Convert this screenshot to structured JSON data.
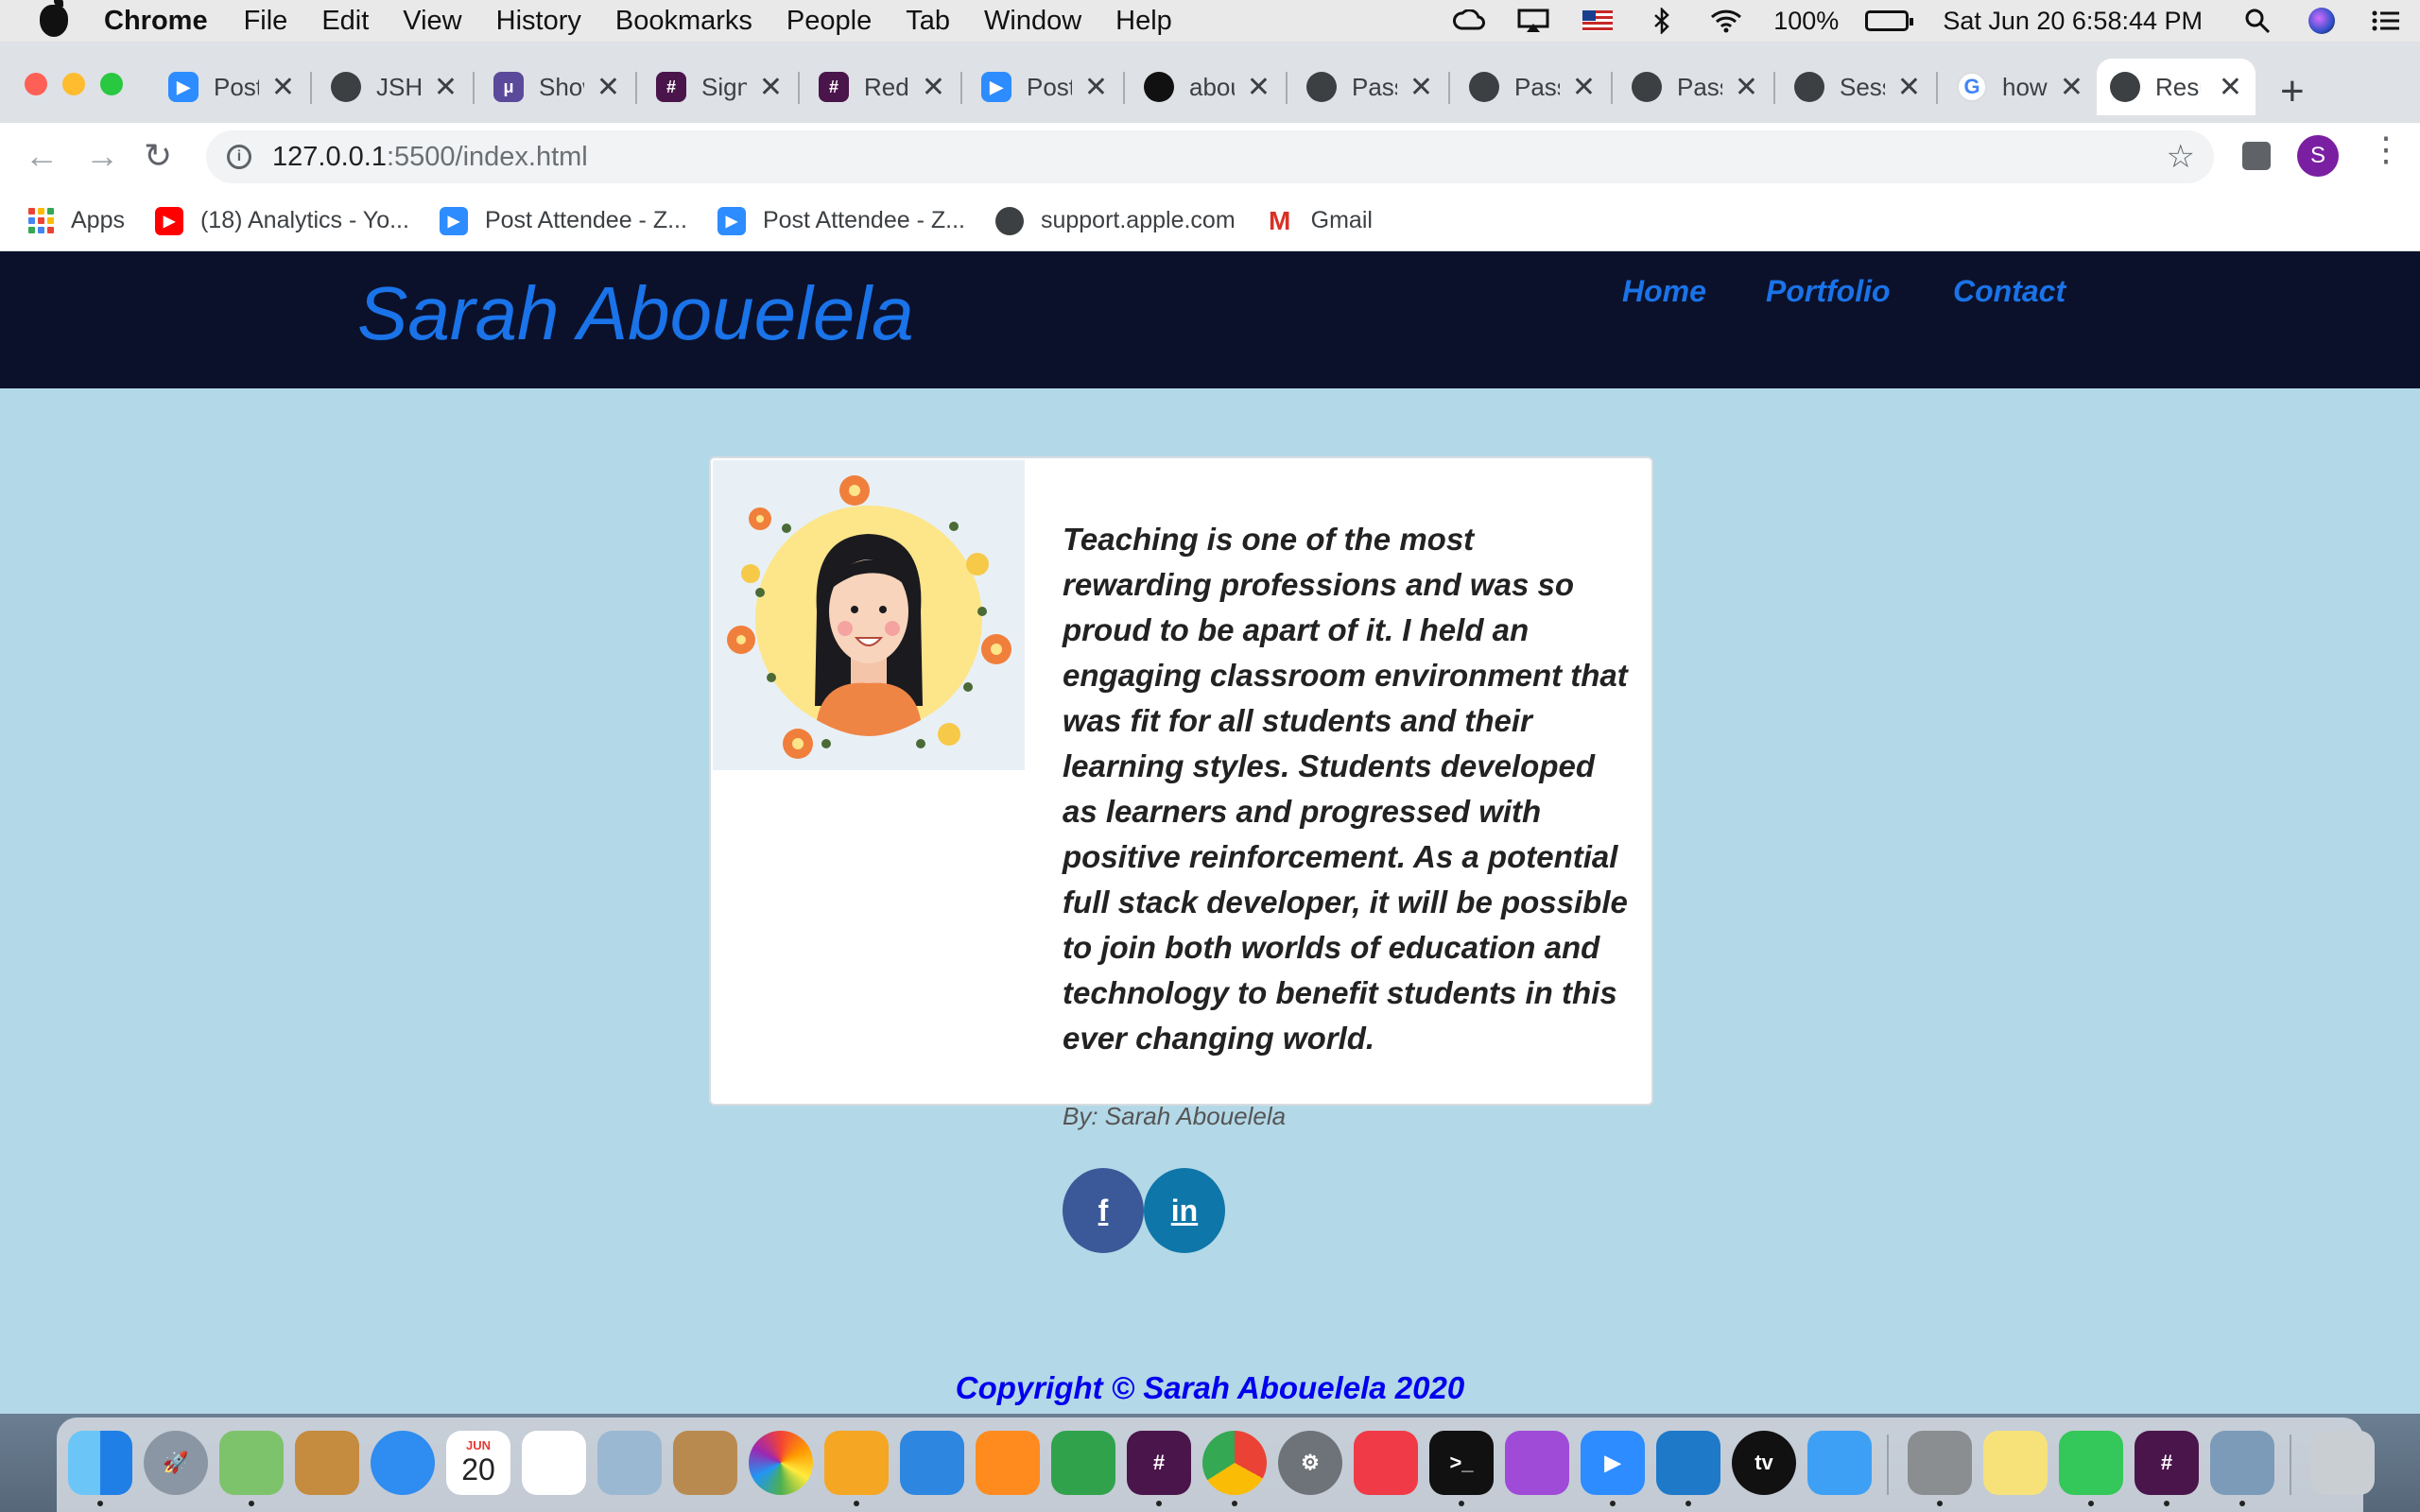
{
  "menubar": {
    "app_name": "Chrome",
    "menus": [
      "File",
      "Edit",
      "View",
      "History",
      "Bookmarks",
      "People",
      "Tab",
      "Window",
      "Help"
    ],
    "battery_text": "100%",
    "datetime": "Sat Jun 20  6:58:44 PM"
  },
  "tabs": [
    {
      "label": "Post Attendee",
      "icon": "zoom-icon"
    },
    {
      "label": "JSHint",
      "icon": "globe-icon"
    },
    {
      "label": "Show",
      "icon": "mu-icon"
    },
    {
      "label": "Sign in",
      "icon": "slack-icon"
    },
    {
      "label": "Redirect",
      "icon": "slack-icon"
    },
    {
      "label": "Post Attendee",
      "icon": "zoom-icon"
    },
    {
      "label": "about",
      "icon": "github-icon"
    },
    {
      "label": "Password",
      "icon": "globe-icon"
    },
    {
      "label": "Password",
      "icon": "globe-icon"
    },
    {
      "label": "Password",
      "icon": "globe-icon"
    },
    {
      "label": "Session",
      "icon": "globe-icon"
    },
    {
      "label": "how",
      "icon": "google-icon"
    },
    {
      "label": "Resume",
      "icon": "globe-icon",
      "active": true
    }
  ],
  "address_bar": {
    "url_host": "127.0.0.1",
    "url_path": ":5500/index.html"
  },
  "profile_initial": "S",
  "bookmarks": [
    {
      "label": "Apps",
      "icon": "apps-grid-icon"
    },
    {
      "label": "(18) Analytics - Yo...",
      "icon": "youtube-icon"
    },
    {
      "label": "Post Attendee - Z...",
      "icon": "zoom-icon"
    },
    {
      "label": "Post Attendee - Z...",
      "icon": "zoom-icon"
    },
    {
      "label": "support.apple.com",
      "icon": "globe-icon"
    },
    {
      "label": "Gmail",
      "icon": "gmail-icon"
    }
  ],
  "site": {
    "title": "Sarah Abouelela",
    "nav": [
      "Home",
      "Portfolio",
      "Contact"
    ],
    "quote": "Teaching is one of the most rewarding professions and was so proud to be apart of it. I held an engaging classroom environment that was fit for all students and their learning styles. Students developed as learners and progressed with positive reinforcement. As a potential full stack developer, it will be possible to join both worlds of education and technology to benefit students in this ever changing world.",
    "byline": "By: Sarah Abouelela",
    "social": [
      {
        "label": "f",
        "icon": "facebook-icon",
        "color": "#3b5998"
      },
      {
        "label": "in",
        "icon": "linkedin-icon",
        "color": "#0e76a8"
      }
    ],
    "footer": "Copyright © Sarah Abouelela 2020"
  },
  "dock": {
    "calendar_month": "JUN",
    "calendar_day": "20",
    "tv_label": "tv",
    "apps": [
      "finder-icon",
      "launchpad-icon",
      "maps-icon",
      "garageband-icon",
      "safari-icon",
      "calendar-icon",
      "reminders-icon",
      "preview-icon",
      "contacts-icon",
      "photos-icon",
      "pages-icon",
      "keynote-icon",
      "books-icon",
      "numbers-icon",
      "slack-icon",
      "chrome-icon",
      "system-preferences-icon",
      "news-icon",
      "terminal-icon",
      "podcasts-icon",
      "zoom-icon",
      "vscode-icon",
      "appletv-icon",
      "xcode-icon",
      "typewriter-icon",
      "notes-icon",
      "facetime-icon",
      "slack-icon",
      "image-capture-icon",
      "trash-icon"
    ]
  },
  "colors": {
    "header_bg": "#0b112b",
    "page_bg": "#b3d8e7",
    "accent": "#1a73e8",
    "footer_text": "#0000ee"
  }
}
